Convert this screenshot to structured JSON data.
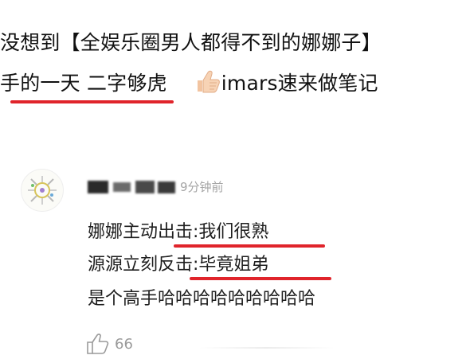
{
  "post": {
    "line1": "没想到【全娱乐圈男人都得不到的娜娜子】",
    "line2_part1": "手的一天 二字够虎",
    "line2_part2": "imars速来做笔记",
    "emoji": "thumbs-up-icon"
  },
  "comment": {
    "timestamp": "9分钟前",
    "lines": [
      "娜娜主动出击:我们很熟",
      "源源立刻反击:毕竟姐弟",
      "是个高手哈哈哈哈哈哈哈哈哈"
    ],
    "like_count": "66",
    "like_icon": "thumbs-up-outline-icon"
  },
  "colors": {
    "underline": "#e0242b",
    "text": "#111111",
    "muted": "#a5a5a5"
  }
}
